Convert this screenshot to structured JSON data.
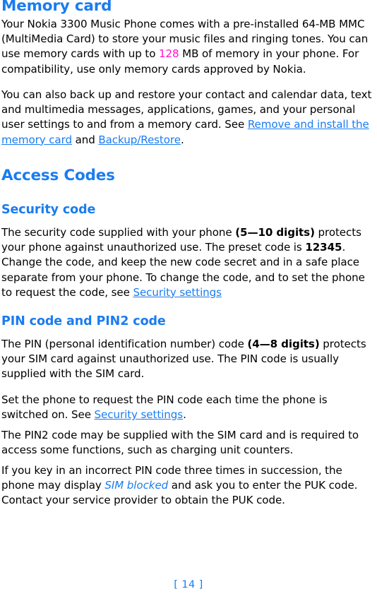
{
  "document": {
    "page_number_label": "[ 14 ]",
    "accent_blue": "#1a7cf0",
    "highlight_magenta": "#ff14cc",
    "body_color": "#000000"
  },
  "sections": {
    "memory_card": {
      "heading": "Memory card",
      "paragraph1": {
        "part1": "Your Nokia 3300 Music Phone comes with a pre-installed 64-MB MMC (MultiMedia Card) to store your music files and ringing tones. You can use memory cards with up to ",
        "highlight": "128",
        "part2": " MB of memory in your phone. For compatibility, use only memory cards approved by Nokia."
      },
      "paragraph2": {
        "part1": "You can also back up and restore your contact and calendar data, text and multimedia messages, applications, games, and your personal user settings to and from a memory card. See ",
        "link1": "Remove and install the memory card",
        "part2": " and ",
        "link2": "Backup/Restore",
        "part3": "."
      }
    },
    "access_codes": {
      "heading": "Access Codes",
      "security_code": {
        "heading": "Security code",
        "paragraph": {
          "part1": "The security code supplied with your phone ",
          "bold1": "(5—10 digits)",
          "part2": " protects your phone against unauthorized use. The preset code is ",
          "bold2": "12345",
          "part3": ". Change the code, and keep the new code secret and in a safe place separate from your phone. To change the code, and to set the phone to request the code, see ",
          "link1": "Security settings"
        }
      },
      "pin_code": {
        "heading": "PIN code and PIN2 code",
        "paragraph1": {
          "part1": "The PIN (personal identification number) code ",
          "bold1": "(4—8 digits)",
          "part2": " protects your SIM card against unauthorized use. The PIN code is usually supplied with the SIM card."
        },
        "paragraph2": {
          "part1": "Set the phone to request the PIN code each time the phone is switched on. See ",
          "link1": "Security settings",
          "part2": "."
        },
        "paragraph3": {
          "text": "The PIN2 code may be supplied with the SIM card and is required to access some functions, such as charging unit counters."
        },
        "paragraph4": {
          "part1": "If you key in an incorrect PIN code three times in succession, the phone may display ",
          "italic1": "SIM blocked",
          "part2": " and ask you to enter the PUK code. Contact your service provider to obtain the PUK code."
        }
      }
    }
  }
}
